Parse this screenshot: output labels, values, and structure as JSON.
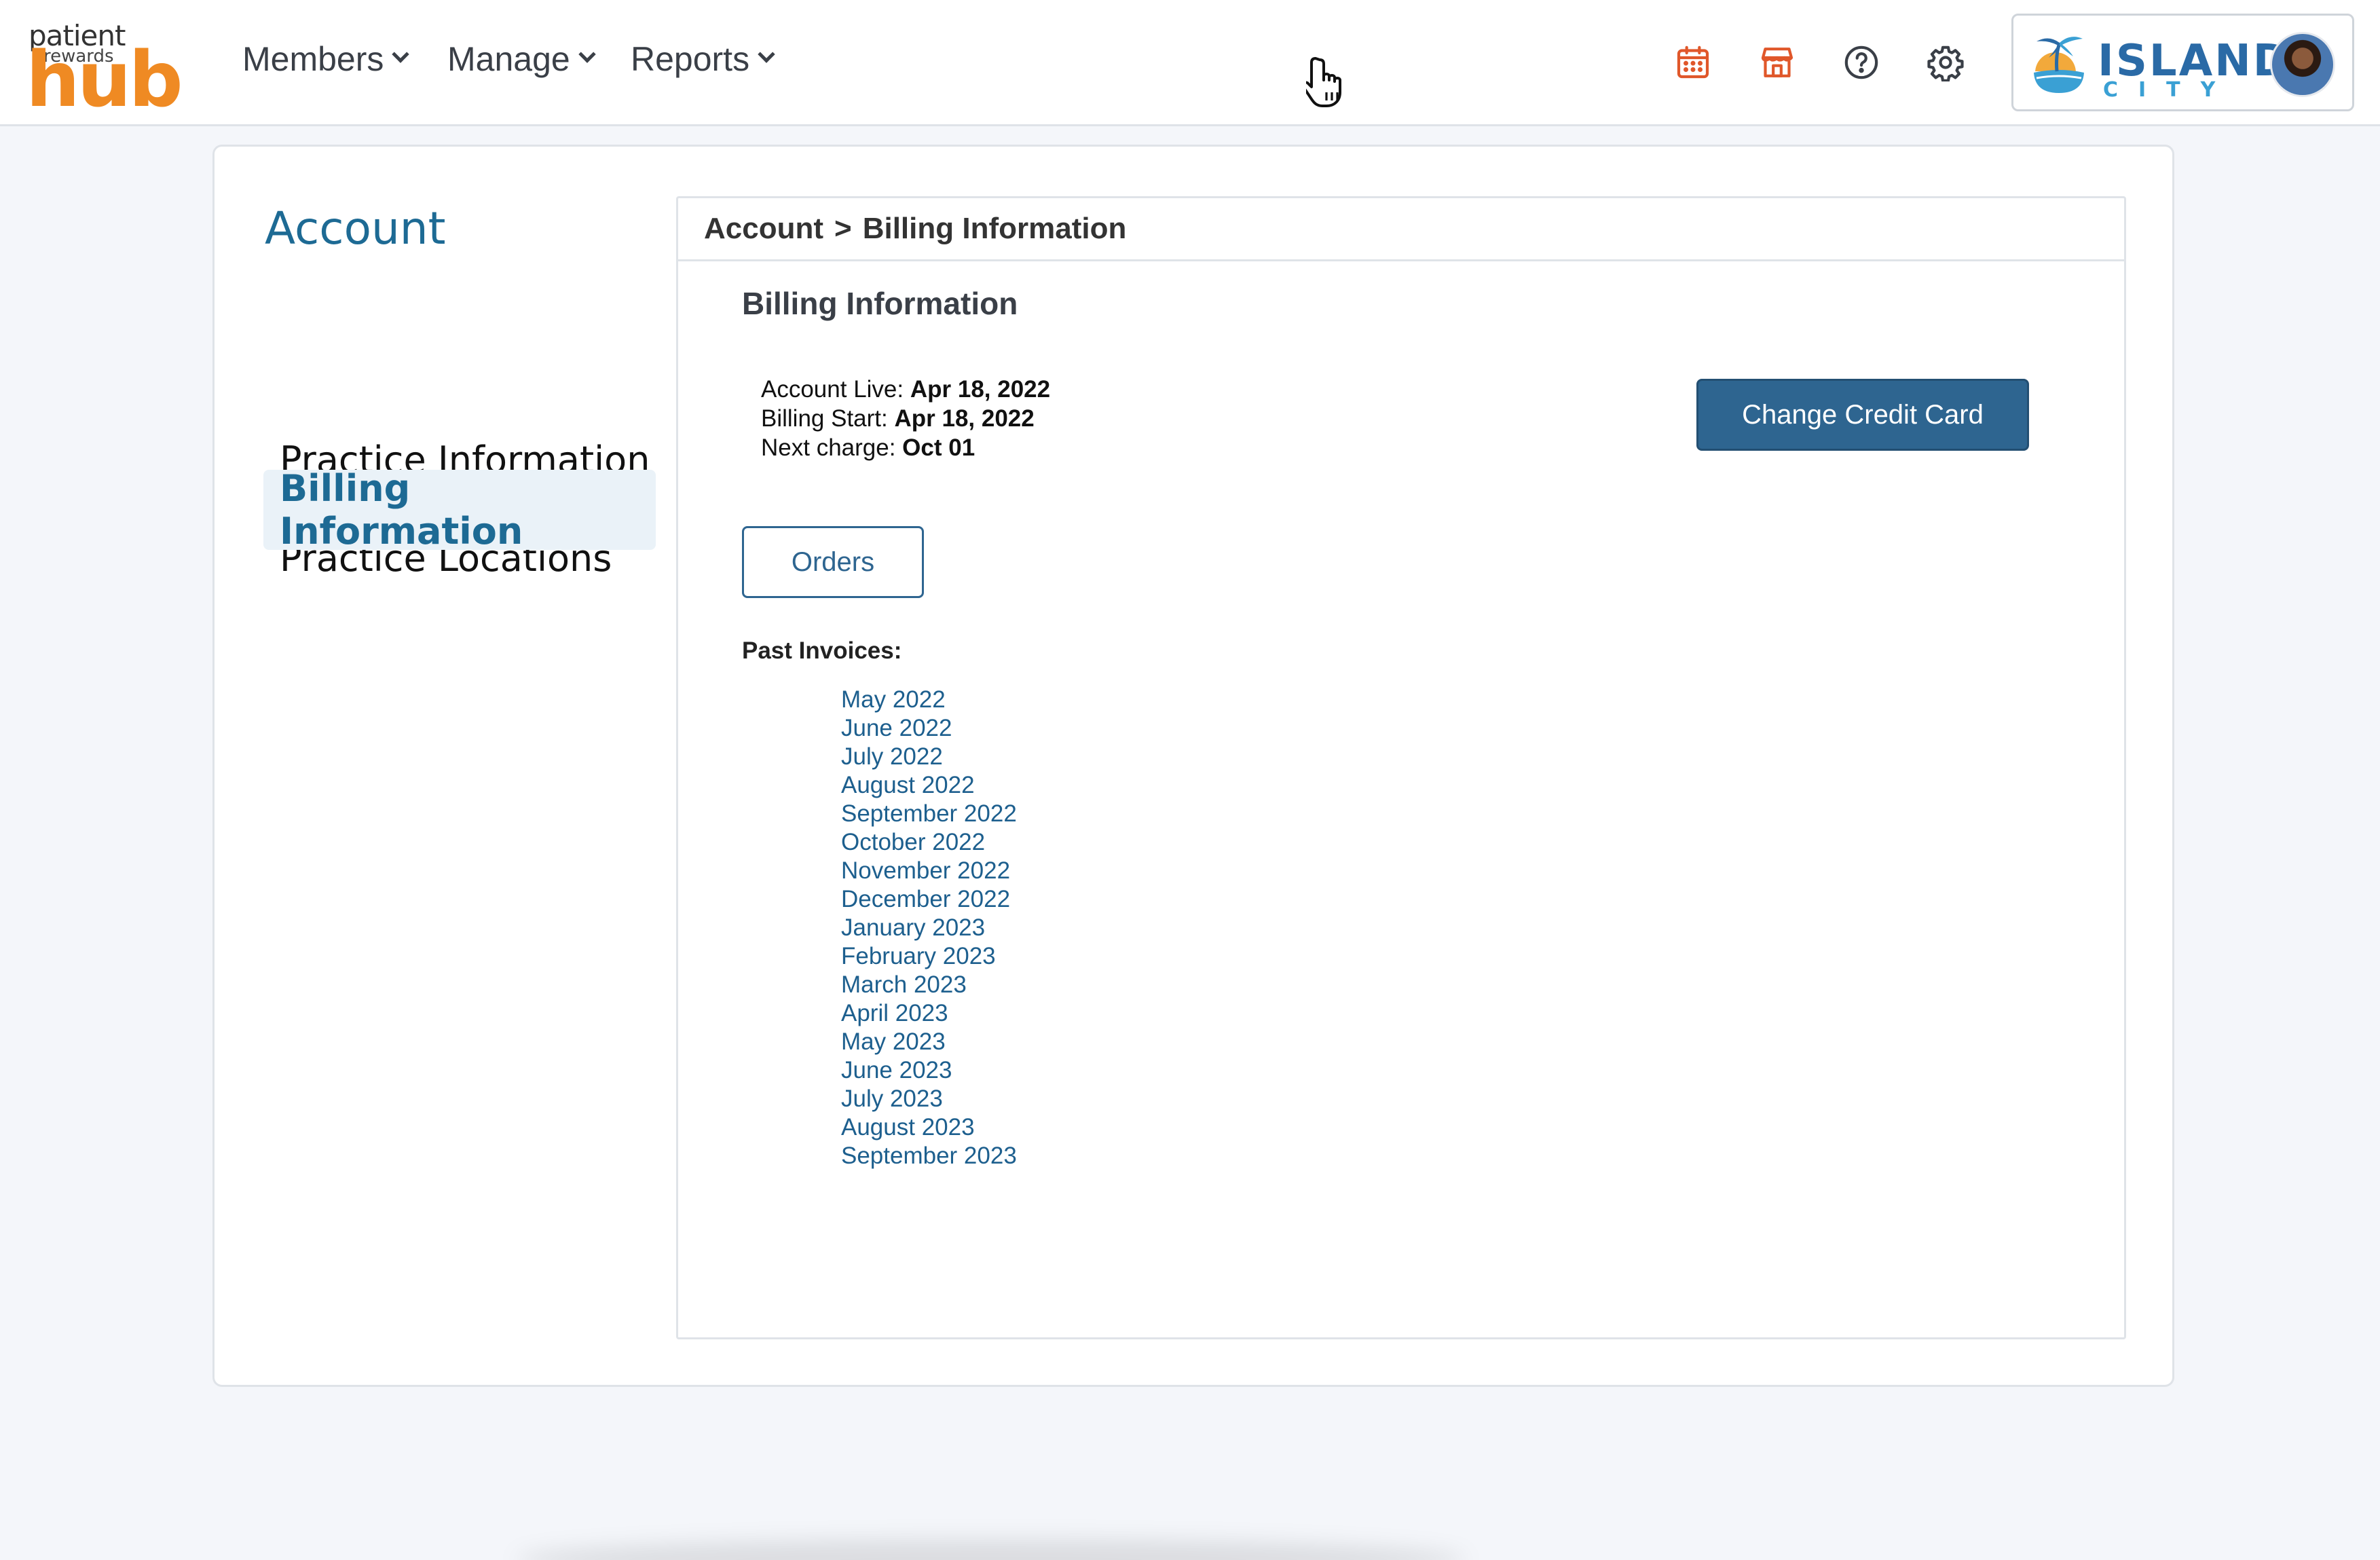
{
  "logo": {
    "line1": "patient",
    "line2": "rewards",
    "line3": "hub"
  },
  "nav": {
    "members": "Members",
    "manage": "Manage",
    "reports": "Reports"
  },
  "toolbar_icons": [
    "calendar-icon",
    "store-icon",
    "help-icon",
    "gear-icon"
  ],
  "brand": {
    "line1": "ISLAND",
    "line2": "CITY"
  },
  "colors": {
    "accent": "#2e6590",
    "link": "#1d5f8e",
    "brand_orange": "#ef8a23",
    "icon_orange": "#e0572a"
  },
  "sidebar": {
    "title": "Account",
    "items": [
      {
        "label": "Practice Information"
      },
      {
        "label": "Practice Locations"
      },
      {
        "label": "Billing Information"
      }
    ]
  },
  "breadcrumb": {
    "parent": "Account",
    "separator": ">",
    "current": "Billing Information"
  },
  "billing": {
    "title": "Billing Information",
    "account_live_label": "Account Live:",
    "account_live_value": "Apr 18, 2022",
    "billing_start_label": "Billing Start:",
    "billing_start_value": "Apr 18, 2022",
    "next_charge_label": "Next charge:",
    "next_charge_value": "Oct 01",
    "change_card_label": "Change Credit Card",
    "orders_label": "Orders",
    "past_invoices_label": "Past Invoices:",
    "invoices": [
      "May 2022",
      "June 2022",
      "July 2022",
      "August 2022",
      "September 2022",
      "October 2022",
      "November 2022",
      "December 2022",
      "January 2023",
      "February 2023",
      "March 2023",
      "April 2023",
      "May 2023",
      "June 2023",
      "July 2023",
      "August 2023",
      "September 2023"
    ]
  }
}
